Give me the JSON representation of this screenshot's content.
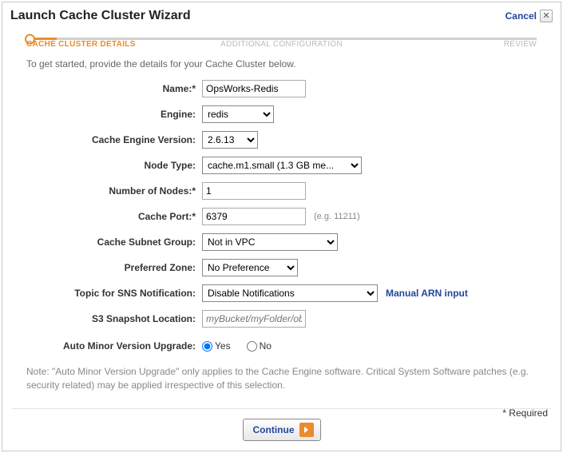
{
  "header": {
    "title": "Launch Cache Cluster Wizard",
    "cancel": "Cancel"
  },
  "steps": {
    "s1": "CACHE CLUSTER DETAILS",
    "s2": "ADDITIONAL CONFIGURATION",
    "s3": "REVIEW"
  },
  "intro": "To get started, provide the details for your Cache Cluster below.",
  "labels": {
    "name": "Name:*",
    "engine": "Engine:",
    "engineVersion": "Cache Engine Version:",
    "nodeType": "Node Type:",
    "numNodes": "Number of Nodes:*",
    "cachePort": "Cache Port:*",
    "cachePortHint": "(e.g. 11211)",
    "subnetGroup": "Cache Subnet Group:",
    "prefZone": "Preferred Zone:",
    "snsTopic": "Topic for SNS Notification:",
    "manualArn": "Manual ARN input",
    "s3snapshot": "S3 Snapshot Location:",
    "s3placeholder": "myBucket/myFolder/objectName",
    "autoMinor": "Auto Minor Version Upgrade:",
    "yes": "Yes",
    "no": "No"
  },
  "values": {
    "name": "OpsWorks-Redis",
    "engine": "redis",
    "engineVersion": "2.6.13",
    "nodeType": "cache.m1.small (1.3 GB me...",
    "numNodes": "1",
    "cachePort": "6379",
    "subnetGroup": "Not in VPC",
    "prefZone": "No Preference",
    "snsTopic": "Disable Notifications"
  },
  "note": "Note: \"Auto Minor Version Upgrade\" only applies to the Cache Engine software. Critical System Software patches (e.g. security related) may be applied irrespective of this selection.",
  "footer": {
    "required": "* Required",
    "continue": "Continue"
  }
}
